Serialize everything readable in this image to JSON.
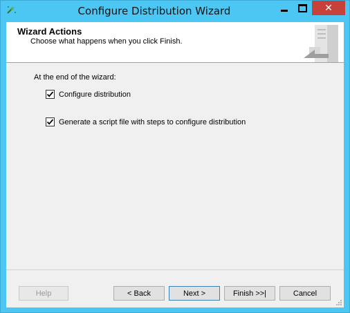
{
  "window": {
    "title": "Configure Distribution Wizard",
    "close_label": "✕"
  },
  "header": {
    "title": "Wizard Actions",
    "subtitle": "Choose what happens when you click Finish."
  },
  "content": {
    "section_label": "At the end of the wizard:",
    "options": [
      {
        "label": "Configure distribution",
        "checked": true
      },
      {
        "label": "Generate a script file with steps to configure distribution",
        "checked": true
      }
    ]
  },
  "footer": {
    "help": "Help",
    "back": "< Back",
    "next": "Next >",
    "finish": "Finish >>|",
    "cancel": "Cancel"
  },
  "colors": {
    "titlebar": "#4cc6f2",
    "close_button": "#c7413b"
  }
}
